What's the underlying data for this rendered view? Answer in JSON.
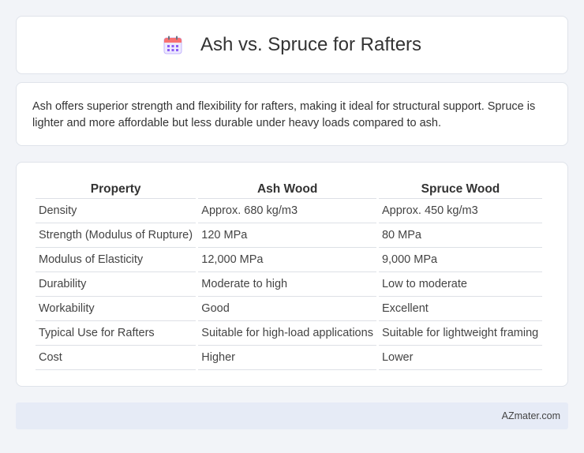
{
  "header": {
    "title": "Ash vs. Spruce for Rafters",
    "icon": "calendar-icon"
  },
  "summary": {
    "text": "Ash offers superior strength and flexibility for rafters, making it ideal for structural support. Spruce is lighter and more affordable but less durable under heavy loads compared to ash."
  },
  "table": {
    "headers": [
      "Property",
      "Ash Wood",
      "Spruce Wood"
    ],
    "rows": [
      [
        "Density",
        "Approx. 680 kg/m3",
        "Approx. 450 kg/m3"
      ],
      [
        "Strength (Modulus of Rupture)",
        "120 MPa",
        "80 MPa"
      ],
      [
        "Modulus of Elasticity",
        "12,000 MPa",
        "9,000 MPa"
      ],
      [
        "Durability",
        "Moderate to high",
        "Low to moderate"
      ],
      [
        "Workability",
        "Good",
        "Excellent"
      ],
      [
        "Typical Use for Rafters",
        "Suitable for high-load applications",
        "Suitable for lightweight framing"
      ],
      [
        "Cost",
        "Higher",
        "Lower"
      ]
    ]
  },
  "footer": {
    "brand": "AZmater.com"
  },
  "colors": {
    "background": "#f2f4f8",
    "card": "#ffffff",
    "footer": "#e6ebf6",
    "icon_accent": "#a78bfa"
  }
}
